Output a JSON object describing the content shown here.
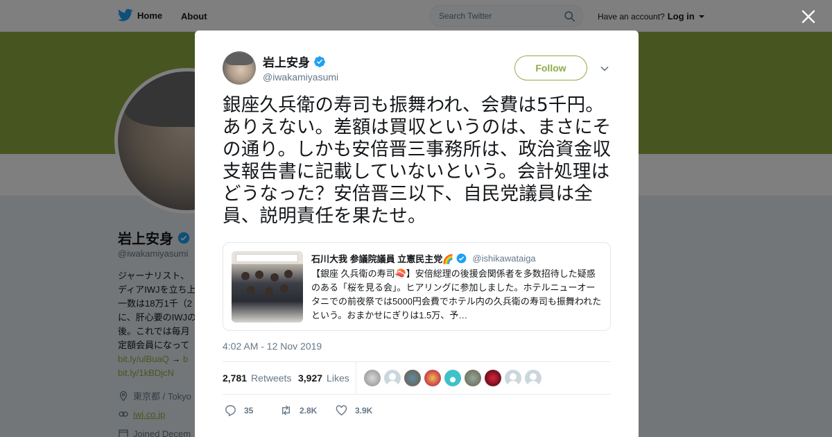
{
  "topbar": {
    "home_label": "Home",
    "about_label": "About",
    "search_placeholder": "Search Twitter",
    "have_account": "Have an account?",
    "login_label": "Log in"
  },
  "profile": {
    "name": "岩上安身",
    "handle": "@iwakamiyasumi",
    "bio_lines": [
      "ジャーナリスト、",
      "ディアIWJを立ち上",
      "一数は18万1千（2",
      "に、肝心要のIWJの",
      "後。これでは毎月",
      "定額会員になって"
    ],
    "link1": "bit.ly/ulBuaQ",
    "link1_arrow": "→",
    "link1_trail": "b",
    "link2": "bit.ly/1kBDjcN",
    "location": "東京都 / Tokyo",
    "website": "iwj.co.jp",
    "joined": "Joined Decem"
  },
  "colors": {
    "accent": "#8eac43",
    "verified": "#1da1f2",
    "text_secondary": "#657786"
  },
  "tweet": {
    "author_name": "岩上安身",
    "author_handle": "@iwakamiyasumi",
    "follow_label": "Follow",
    "text": "銀座久兵衛の寿司も振舞われ、会費は5千円。ありえない。差額は買収というのは、まさにその通り。しかも安倍晋三事務所は、政治資金収支報告書に記載していないという。会計処理はどうなった？安倍晋三以下、自民党議員は全員、説明責任を果たせ。",
    "timestamp": "4:02 AM - 12 Nov 2019",
    "retweets_count": "2,781",
    "retweets_label": "Retweets",
    "likes_count": "3,927",
    "likes_label": "Likes",
    "replies_short": "35",
    "retweets_short": "2.8K",
    "likes_short": "3.9K"
  },
  "quote": {
    "name": "石川大我 参議院議員 立憲民主党🌈",
    "handle": "@ishikawataiga",
    "text": "【銀座 久兵衛の寿司🍣】安倍総理の後援会関係者を多数招待した疑惑のある「桜を見る会」。ヒアリングに参加しました。ホテルニューオータニでの前夜祭では5000円会費でホテル内の久兵衛の寿司も振舞われたという。おまかせにぎりは1.5万、予…"
  }
}
